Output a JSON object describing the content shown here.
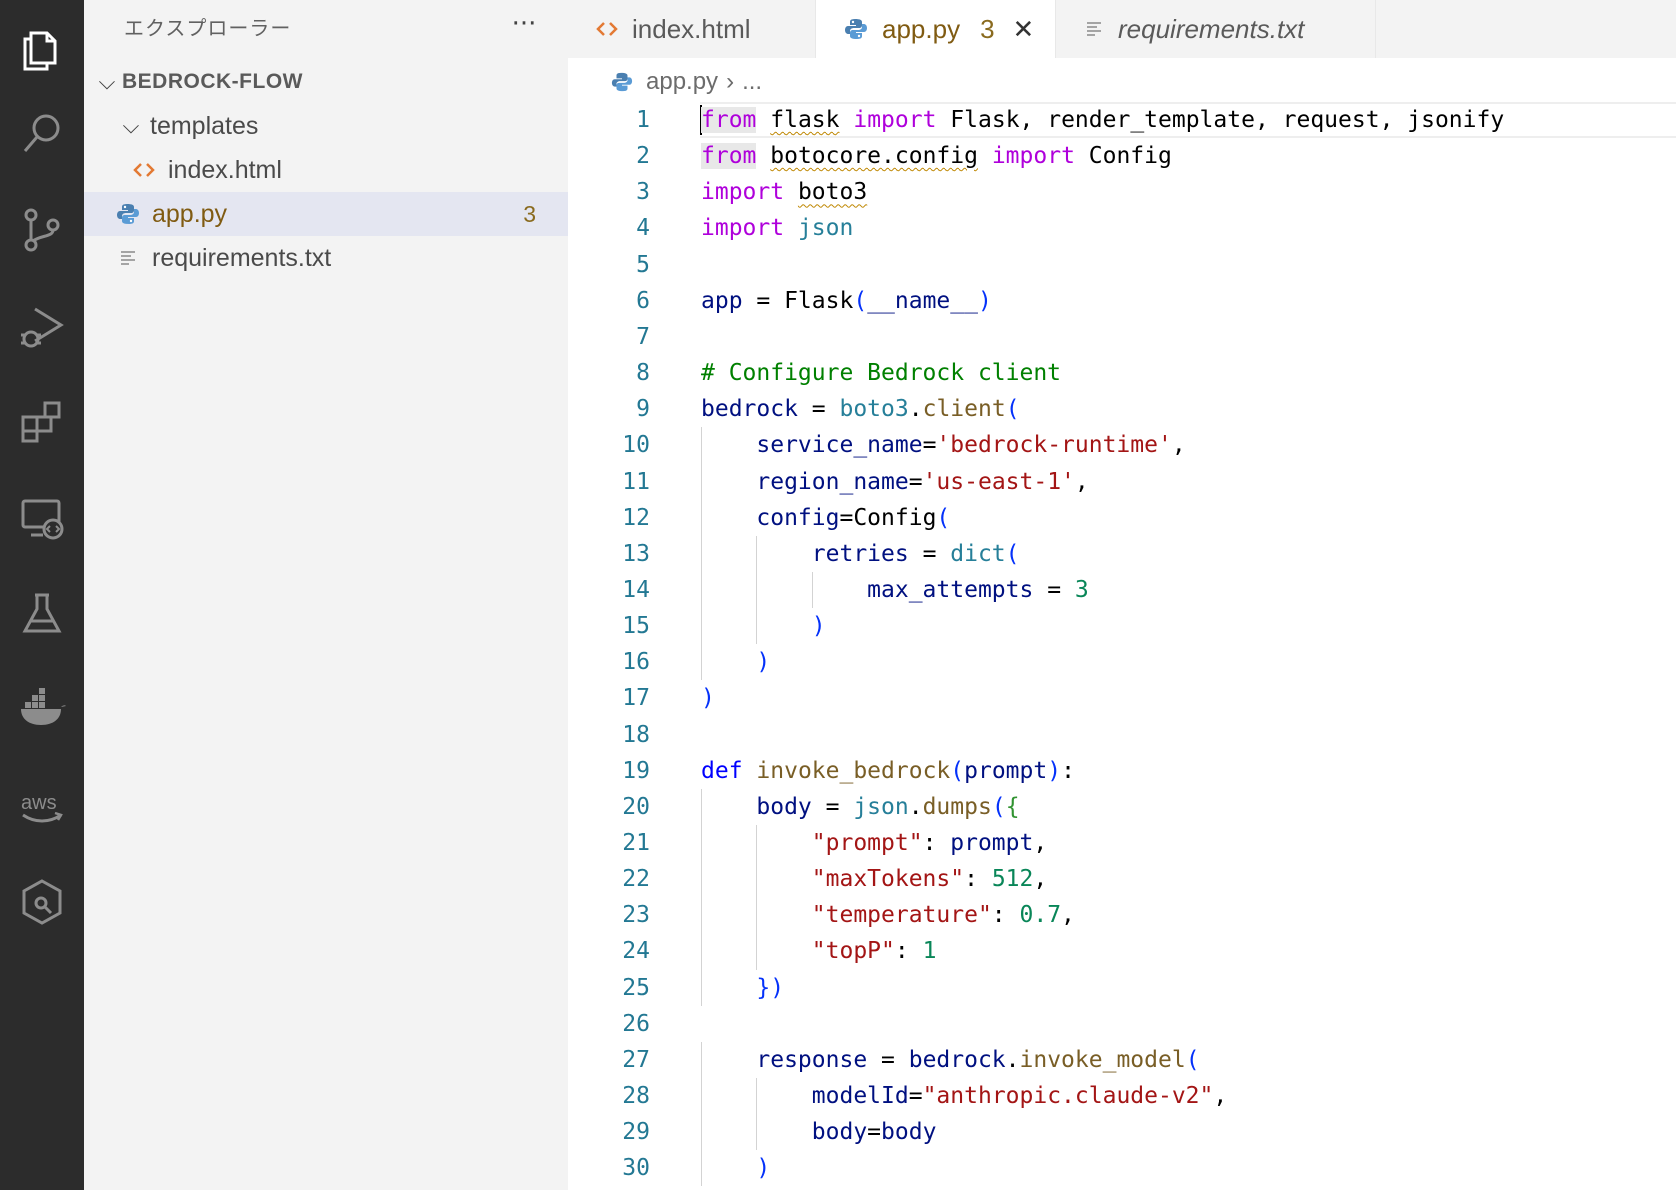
{
  "sidebar": {
    "title": "エクスプローラー",
    "more": "···",
    "root": {
      "label": "BEDROCK-FLOW"
    },
    "items": [
      {
        "label": "templates",
        "type": "folder"
      },
      {
        "label": "index.html",
        "type": "html"
      },
      {
        "label": "app.py",
        "type": "python",
        "badge": "3"
      },
      {
        "label": "requirements.txt",
        "type": "text"
      }
    ]
  },
  "tabs": [
    {
      "label": "index.html",
      "icon": "html-icon"
    },
    {
      "label": "app.py",
      "icon": "python-icon",
      "badge": "3",
      "close": "✕"
    },
    {
      "label": "requirements.txt",
      "icon": "text-file-icon"
    }
  ],
  "breadcrumb": {
    "file": "app.py",
    "sep": "›",
    "rest": "..."
  },
  "activity_bar": [
    "explorer-icon",
    "search-icon",
    "source-control-icon",
    "run-debug-icon",
    "extensions-icon",
    "remote-explorer-icon",
    "testing-icon",
    "docker-icon",
    "aws-icon",
    "hexagon-icon"
  ],
  "aws_label": "aws",
  "code": {
    "line_numbers": [
      "1",
      "2",
      "3",
      "4",
      "5",
      "6",
      "7",
      "8",
      "9",
      "10",
      "11",
      "12",
      "13",
      "14",
      "15",
      "16",
      "17",
      "18",
      "19",
      "20",
      "21",
      "22",
      "23",
      "24",
      "25",
      "26",
      "27",
      "28",
      "29",
      "30"
    ],
    "lines": [
      "from flask import Flask, render_template, request, jsonify",
      "from botocore.config import Config",
      "import boto3",
      "import json",
      "",
      "app = Flask(__name__)",
      "",
      "# Configure Bedrock client",
      "bedrock = boto3.client(",
      "    service_name='bedrock-runtime',",
      "    region_name='us-east-1',",
      "    config=Config(",
      "        retries = dict(",
      "            max_attempts = 3",
      "        )",
      "    )",
      ")",
      "",
      "def invoke_bedrock(prompt):",
      "    body = json.dumps({",
      "        \"prompt\": prompt,",
      "        \"maxTokens\": 512,",
      "        \"temperature\": 0.7,",
      "        \"topP\": 1",
      "    })",
      "",
      "    response = bedrock.invoke_model(",
      "        modelId=\"anthropic.claude-v2\",",
      "        body=body",
      "    )"
    ]
  },
  "colors": {
    "activity_bar": "#2c2c2c",
    "sidebar": "#f3f3f3",
    "selected_row": "#e4e6f1",
    "keyword_import": "#af00db",
    "keyword_def": "#0000ff",
    "string": "#a31515",
    "number": "#098658",
    "comment": "#008000",
    "line_number": "#237893"
  }
}
